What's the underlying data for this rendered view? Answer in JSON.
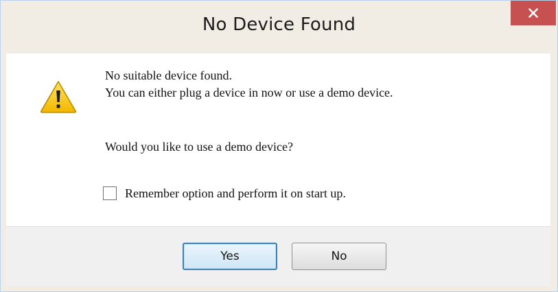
{
  "dialog": {
    "title": "No Device Found",
    "close_icon": "close-icon",
    "warning_icon": "warning-icon",
    "message_line1": "No suitable device found.",
    "message_line2": "You can either plug a device in now or use a demo device.",
    "question": "Would you like to use a demo device?",
    "remember_label": "Remember option and perform it on start up.",
    "remember_checked": false,
    "yes_label": "Yes",
    "no_label": "No"
  },
  "colors": {
    "close_button": "#c75050",
    "warning_fill": "#f5c400",
    "default_button_border": "#3c7fb1"
  }
}
